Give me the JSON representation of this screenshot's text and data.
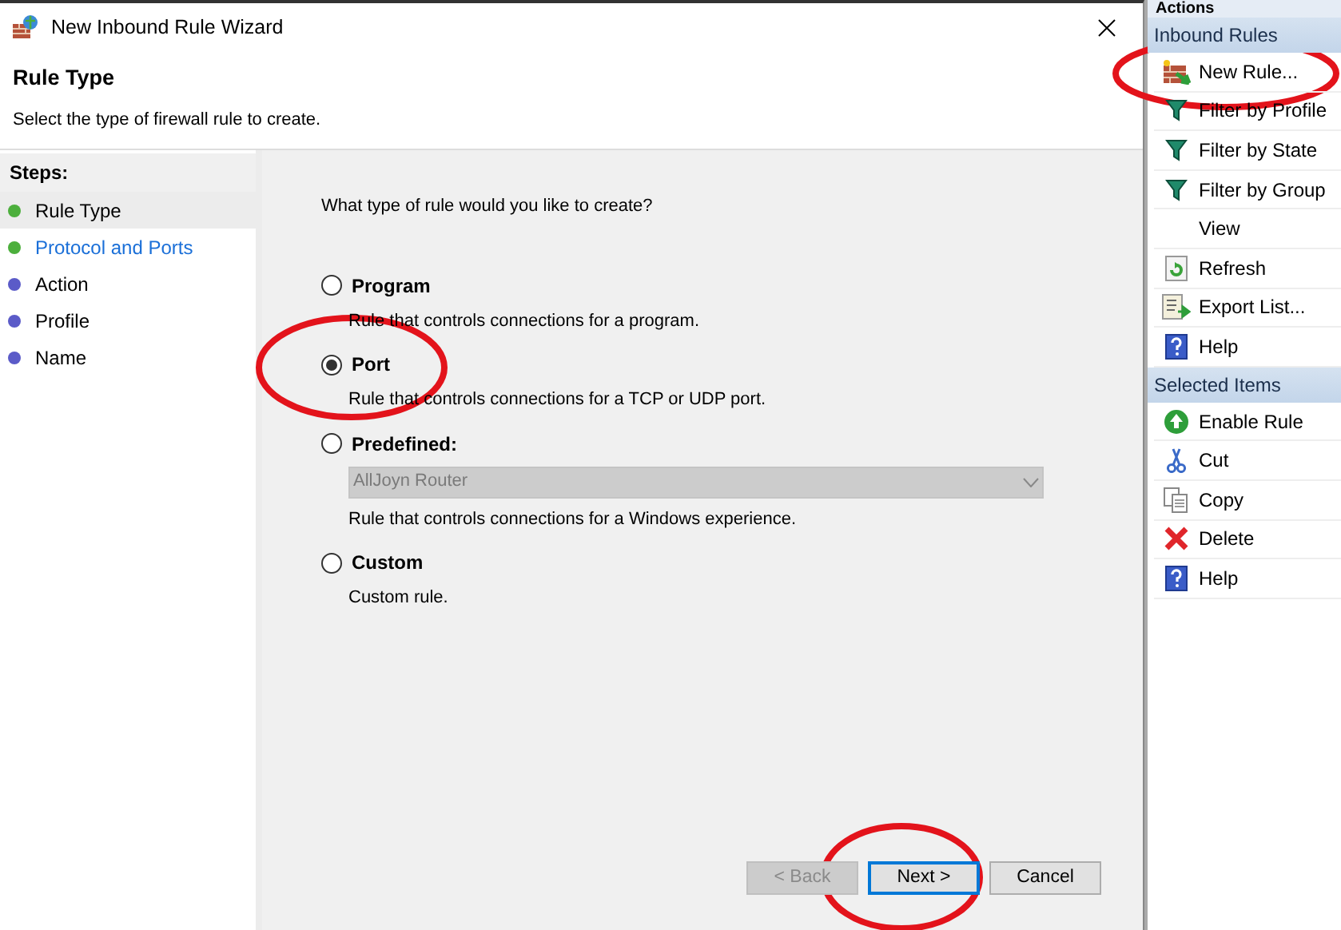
{
  "window": {
    "title": "New Inbound Rule Wizard"
  },
  "header": {
    "title": "Rule Type",
    "subtitle": "Select the type of firewall rule to create."
  },
  "steps": {
    "label": "Steps:",
    "items": [
      {
        "label": "Rule Type",
        "selected": true,
        "kind": "plain",
        "color": "#4caf3c"
      },
      {
        "label": "Protocol and Ports",
        "selected": false,
        "kind": "link",
        "color": "#4caf3c"
      },
      {
        "label": "Action",
        "selected": false,
        "kind": "plain",
        "color": "#5b5bc8"
      },
      {
        "label": "Profile",
        "selected": false,
        "kind": "plain",
        "color": "#5b5bc8"
      },
      {
        "label": "Name",
        "selected": false,
        "kind": "plain",
        "color": "#5b5bc8"
      }
    ]
  },
  "question": "What type of rule would you like to create?",
  "options": [
    {
      "label": "Program",
      "description": "Rule that controls connections for a program.",
      "selected": false
    },
    {
      "label": "Port",
      "description": "Rule that controls connections for a TCP or UDP port.",
      "selected": true
    },
    {
      "label": "Predefined:",
      "description": "Rule that controls connections for a Windows experience.",
      "selected": false,
      "dropdown": {
        "value": "AllJoyn Router",
        "disabled": true
      }
    },
    {
      "label": "Custom",
      "description": "Custom rule.",
      "selected": false
    }
  ],
  "buttons": [
    {
      "label": "< Back",
      "disabled": true,
      "focused": false
    },
    {
      "label": "Next >",
      "disabled": false,
      "focused": true
    },
    {
      "label": "Cancel",
      "disabled": false,
      "focused": false
    }
  ],
  "actions_pane": {
    "title": "Actions",
    "sections": [
      {
        "title": "Inbound Rules",
        "items": [
          {
            "label": "New Rule...",
            "kind": "new-rule"
          },
          {
            "label": "Filter by Profile",
            "kind": "filter"
          },
          {
            "label": "Filter by State",
            "kind": "filter"
          },
          {
            "label": "Filter by Group",
            "kind": "filter"
          },
          {
            "label": "View",
            "kind": "plain"
          },
          {
            "label": "Refresh",
            "kind": "refresh"
          },
          {
            "label": "Export List...",
            "kind": "export"
          },
          {
            "label": "Help",
            "kind": "help"
          }
        ]
      },
      {
        "title": "Selected Items",
        "items": [
          {
            "label": "Enable Rule",
            "kind": "enable"
          },
          {
            "label": "Cut",
            "kind": "cut"
          },
          {
            "label": "Copy",
            "kind": "copy"
          },
          {
            "label": "Delete",
            "kind": "delete"
          },
          {
            "label": "Help",
            "kind": "help"
          }
        ]
      }
    ]
  }
}
